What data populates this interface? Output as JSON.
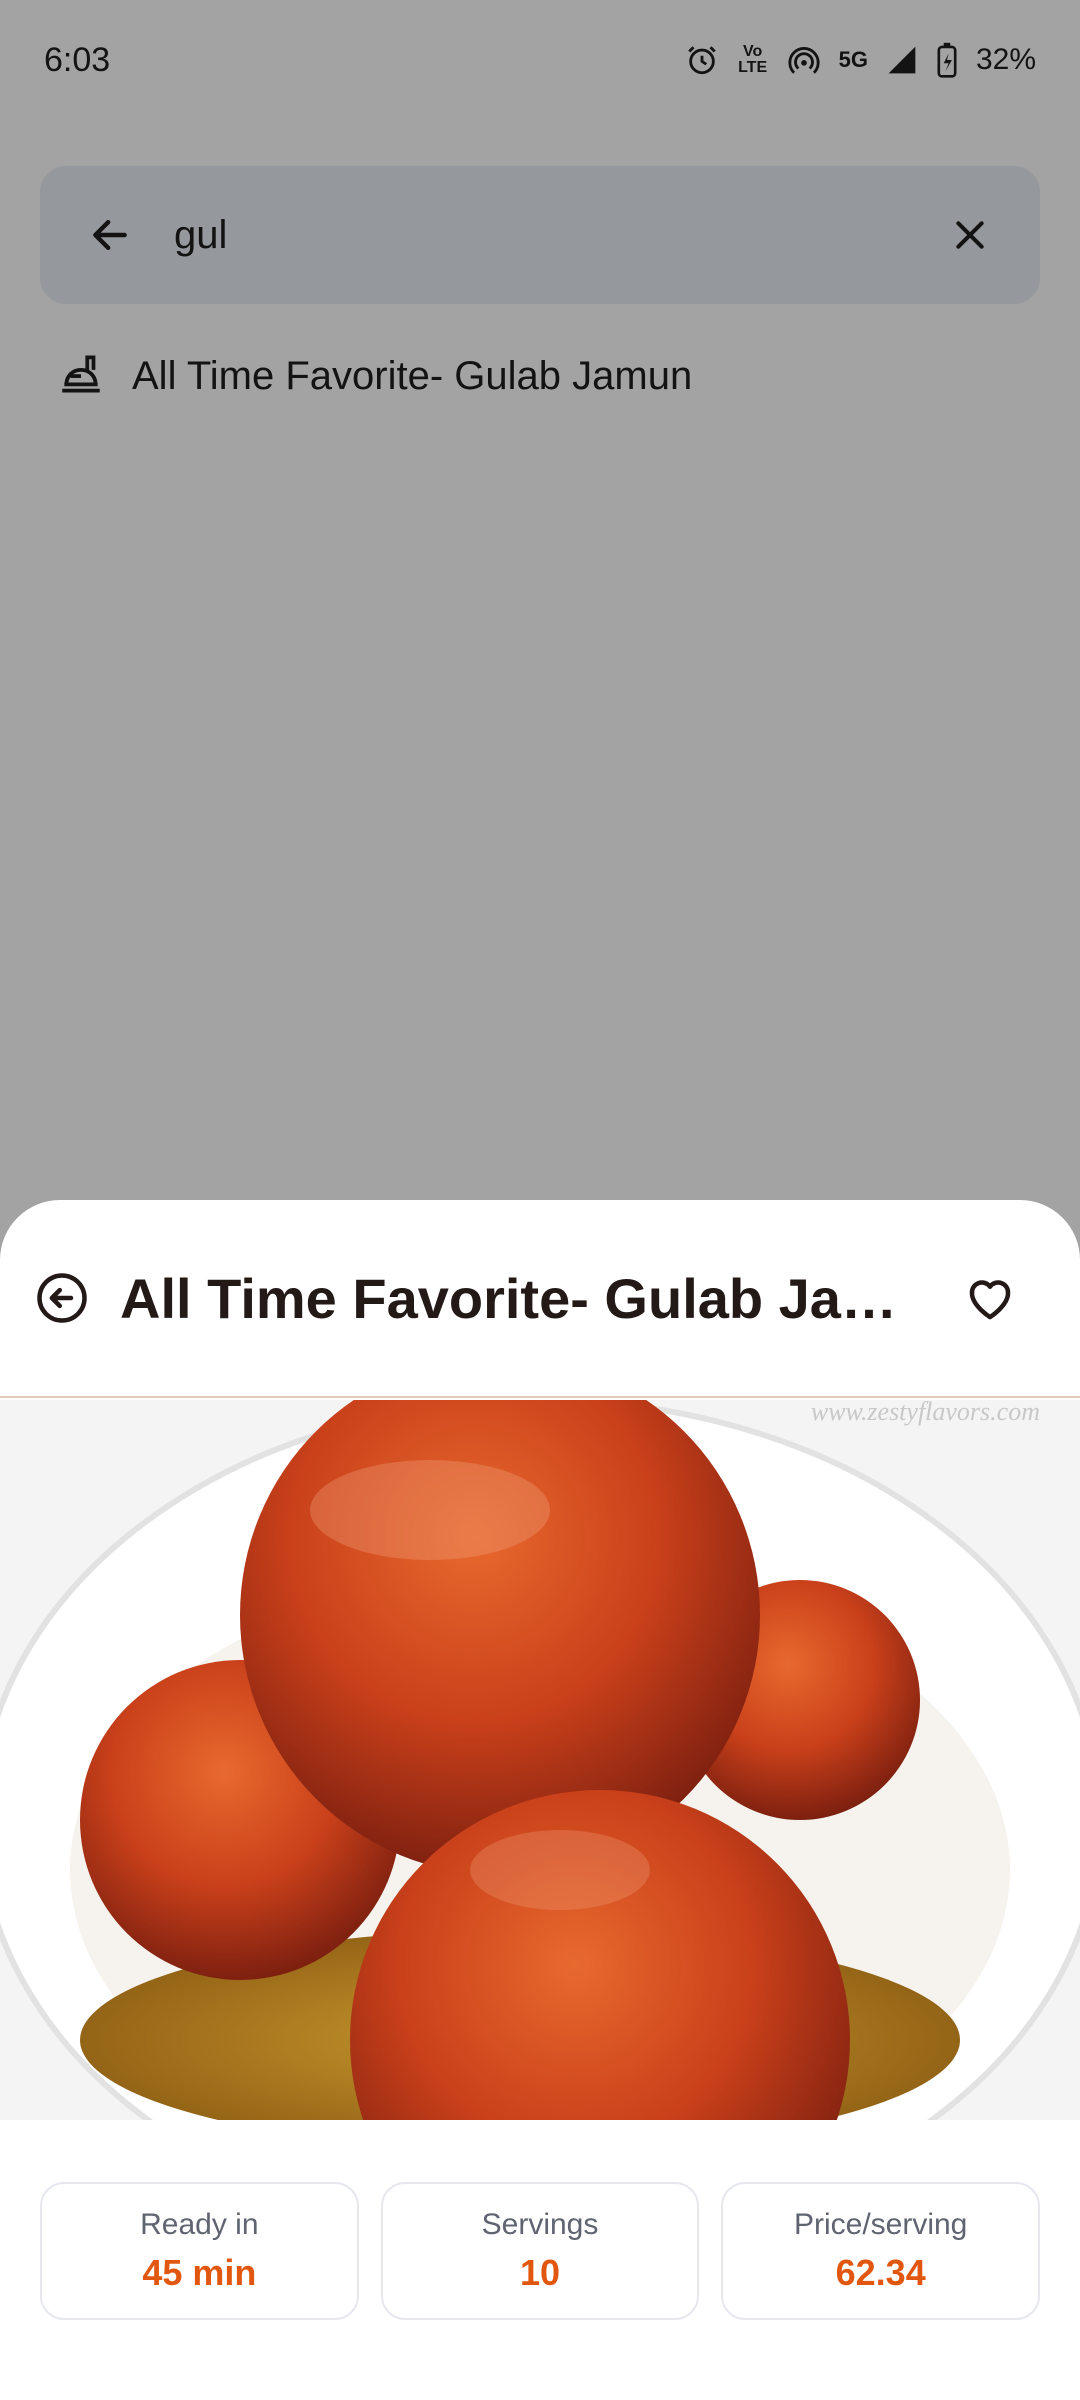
{
  "status_bar": {
    "time": "6:03",
    "battery": "32%",
    "network": "5G",
    "volte": "Vo LTE",
    "icons": [
      "alarm-icon",
      "volte-icon",
      "hotspot-icon",
      "signal-icon",
      "battery-icon"
    ]
  },
  "search": {
    "query": "gul",
    "suggestions": [
      {
        "label": "All Time Favorite- Gulab Jamun",
        "icon": "recipe-icon"
      }
    ]
  },
  "detail": {
    "title": "All Time Favorite- Gulab Jamun",
    "image_watermark": "www.zestyflavors.com",
    "stats": [
      {
        "label": "Ready in",
        "value": "45 min"
      },
      {
        "label": "Servings",
        "value": "10"
      },
      {
        "label": "Price/serving",
        "value": "62.34"
      }
    ]
  },
  "colors": {
    "accent": "#e25710",
    "title": "#231917",
    "search_bg": "#e9eef6"
  }
}
